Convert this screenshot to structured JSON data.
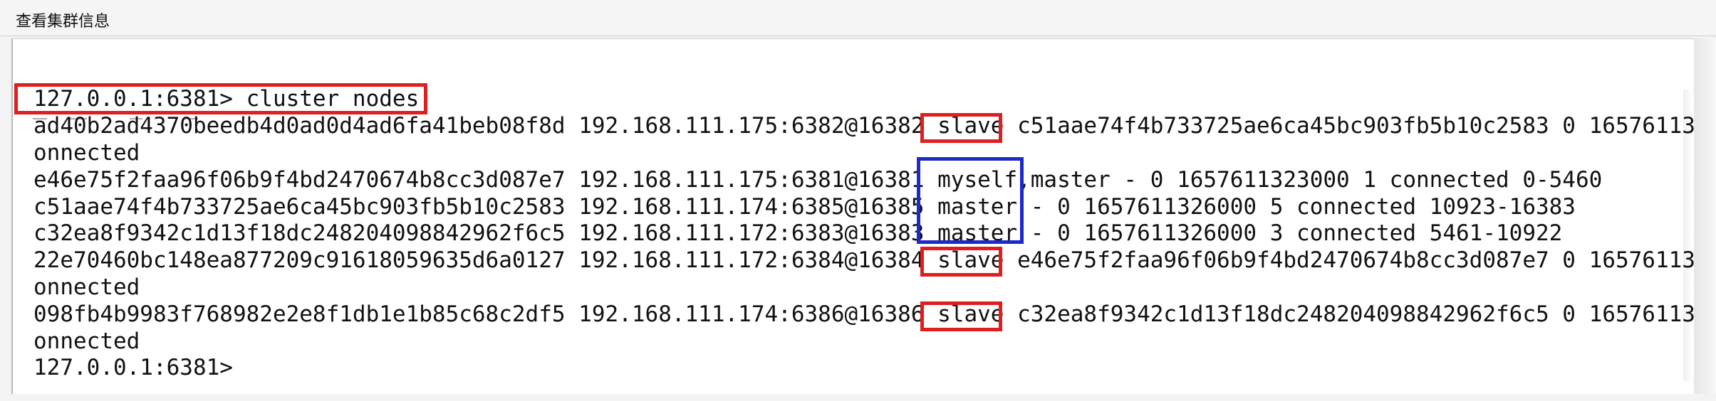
{
  "window": {
    "title": "查看集群信息"
  },
  "terminal": {
    "command_line": "127.0.0.1:6381> cluster nodes",
    "lines": [
      "ad40b2ad4370beedb4d0ad0d4ad6fa41beb08f8d 192.168.111.175:6382@16382 slave c51aae74f4b733725ae6ca45bc903fb5b10c2583 0 16576113",
      "onnected",
      "e46e75f2faa96f06b9f4bd2470674b8cc3d087e7 192.168.111.175:6381@16381 myself,master - 0 1657611323000 1 connected 0-5460",
      "c51aae74f4b733725ae6ca45bc903fb5b10c2583 192.168.111.174:6385@16385 master - 0 1657611326000 5 connected 10923-16383",
      "c32ea8f9342c1d13f18dc248204098842962f6c5 192.168.111.172:6383@16383 master - 0 1657611326000 3 connected 5461-10922",
      "22e70460bc148ea877209c91618059635d6a0127 192.168.111.172:6384@16384 slave e46e75f2faa96f06b9f4bd2470674b8cc3d087e7 0 16576113",
      "onnected",
      "098fb4b9983f768982e2e8f1db1e1b85c68c2df5 192.168.111.174:6386@16386 slave c32ea8f9342c1d13f18dc248204098842962f6c5 0 16576113",
      "onnected",
      "127.0.0.1:6381>"
    ]
  },
  "annotations": {
    "red_color": "#dd1f1f",
    "blue_color": "#1d2ac8"
  }
}
